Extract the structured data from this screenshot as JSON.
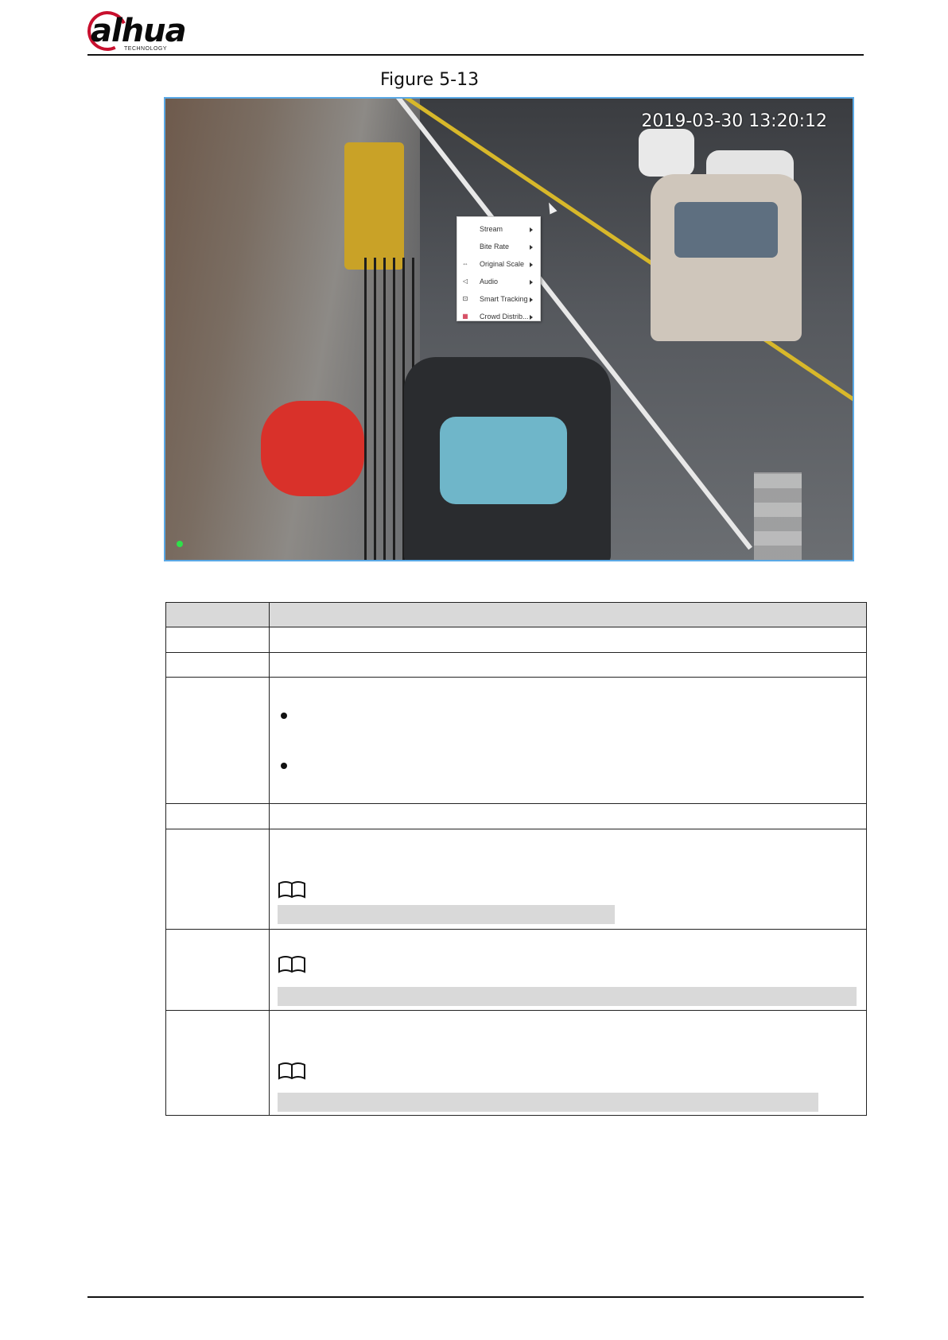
{
  "header": {
    "logo_text": "alhua",
    "logo_subtext": "TECHNOLOGY"
  },
  "figure": {
    "caption": "Figure 5-13"
  },
  "video": {
    "timestamp": "2019-03-30 13:20:12"
  },
  "context_menu": {
    "items": [
      {
        "label": "Stream",
        "icon": "none"
      },
      {
        "label": "Bite Rate",
        "icon": "none"
      },
      {
        "label": "Original Scale",
        "icon": "scale-icon"
      },
      {
        "label": "Audio",
        "icon": "speaker-icon"
      },
      {
        "label": "Smart Tracking",
        "icon": "tracking-icon"
      },
      {
        "label": "Crowd Distrib...",
        "icon": "crowd-icon"
      }
    ]
  },
  "colors": {
    "frame_border": "#5aa9e6",
    "logo_red": "#c8102e",
    "table_header_bg": "#d9d9d9",
    "note_bar": "#d9d9d9"
  }
}
